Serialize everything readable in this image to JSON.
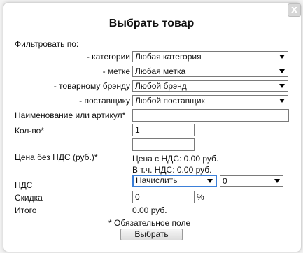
{
  "dialog": {
    "title": "Выбрать товар",
    "close_label": "x",
    "filter_heading": "Фильтровать по:",
    "filters": [
      {
        "label": "- категории",
        "value": "Любая категория"
      },
      {
        "label": "- метке",
        "value": "Любая метка"
      },
      {
        "label": "- товарному брэнду",
        "value": "Любой брэнд"
      },
      {
        "label": "- поставщику",
        "value": "Любой поставщик"
      }
    ],
    "name_label": "Наименование или артикул*",
    "name_value": "",
    "qty_label": "Кол-во*",
    "qty_value": "1",
    "qty_extra_value": "",
    "price_label": "Цена без НДС (руб.)*",
    "price_value": "",
    "price_with_vat": "Цена с НДС: 0.00 руб.",
    "vat_included": "В т.ч. НДС: 0.00 руб.",
    "vat_label": "НДС",
    "vat_mode": "Начислить",
    "vat_rate": "0",
    "discount_label": "Скидка",
    "discount_value": "0",
    "discount_unit": "%",
    "total_label": "Итого",
    "total_value": "0.00 руб.",
    "required_note": "* Обязательное поле",
    "submit_label": "Выбрать"
  }
}
